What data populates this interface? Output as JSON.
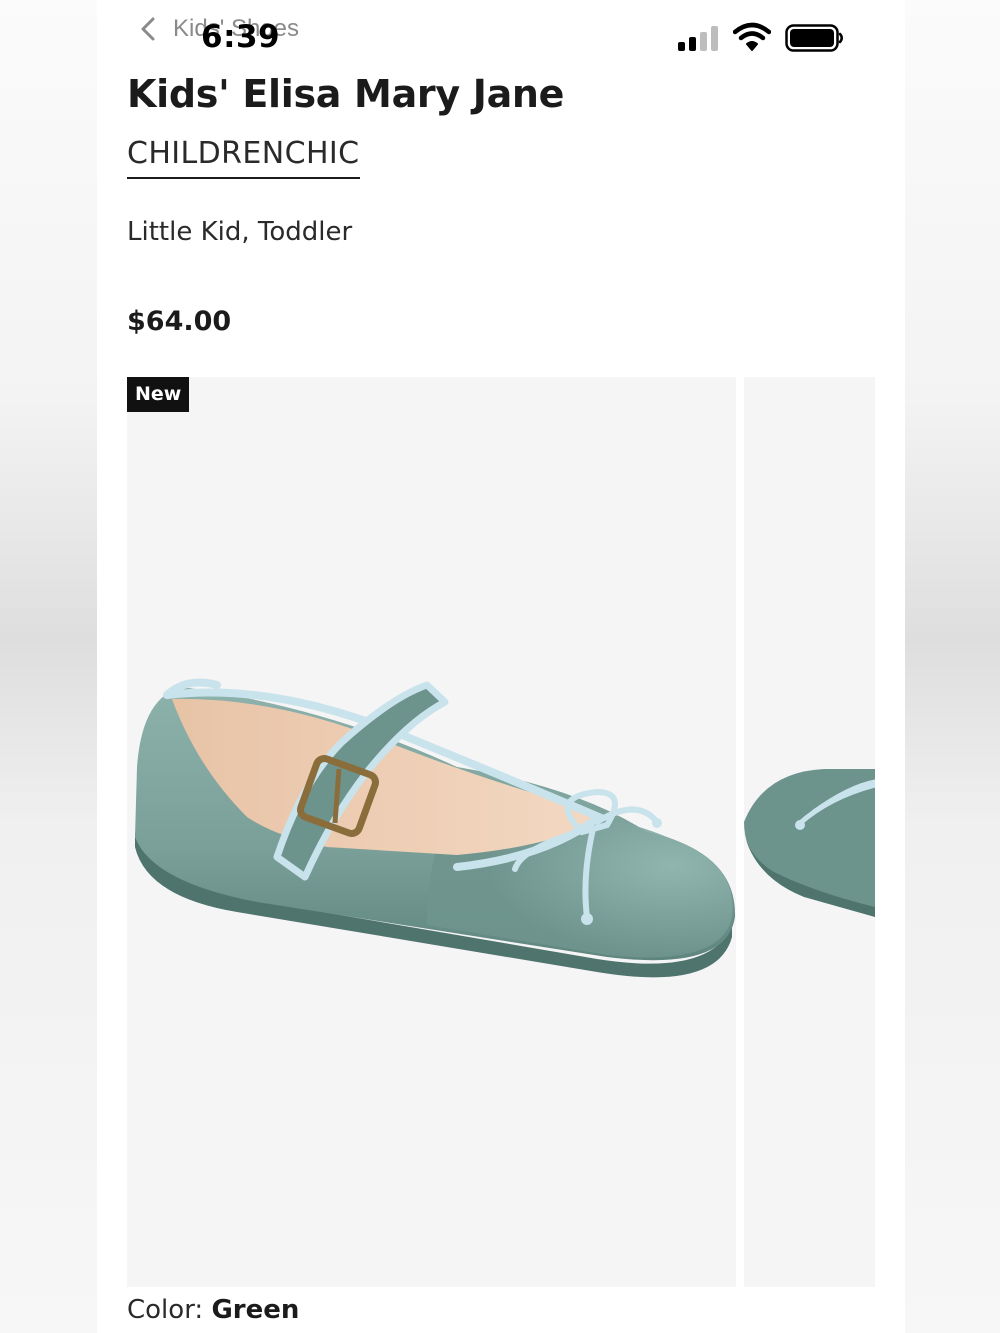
{
  "status_bar": {
    "time": "6:39"
  },
  "nav": {
    "back_label": "Kids' Shoes"
  },
  "product": {
    "title": "Kids' Elisa Mary Jane",
    "brand": "CHILDRENCHIC",
    "size_range": "Little Kid, Toddler",
    "price": "$64.00",
    "badge": "New"
  },
  "color": {
    "label": "Color:",
    "value": "Green"
  },
  "icons": [
    "chevron-left-icon",
    "cellular-signal-icon",
    "wifi-icon",
    "battery-icon"
  ],
  "colors": {
    "shoe_velvet": "#7fa59f",
    "shoe_trim": "#c9e3ec",
    "image_bg": "#f5f5f5",
    "badge_bg": "#111111"
  }
}
